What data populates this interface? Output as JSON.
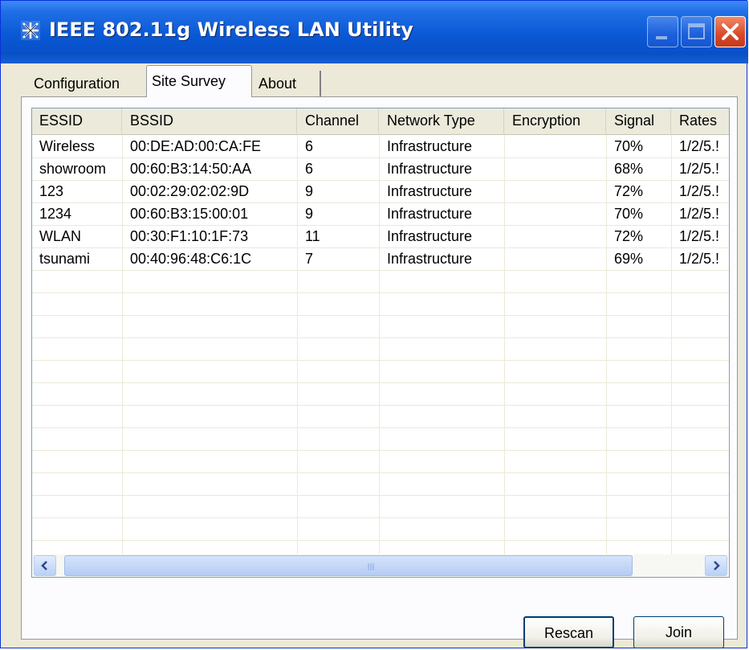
{
  "window": {
    "title": "IEEE 802.11g Wireless LAN Utility",
    "titlebar_color": "#0a58d4",
    "controls": [
      "minimize-icon",
      "maximize-icon",
      "close-icon"
    ]
  },
  "tabs": [
    {
      "label": "Configuration",
      "active": false
    },
    {
      "label": "Site Survey",
      "active": true
    },
    {
      "label": "About",
      "active": false
    }
  ],
  "site_survey": {
    "columns": [
      "ESSID",
      "BSSID",
      "Channel",
      "Network Type",
      "Encryption",
      "Signal",
      "Rates"
    ],
    "rows": [
      [
        "Wireless",
        "00:DE:AD:00:CA:FE",
        "6",
        "Infrastructure",
        "",
        "70%",
        "1/2/5.!"
      ],
      [
        "showroom",
        "00:60:B3:14:50:AA",
        "6",
        "Infrastructure",
        "",
        "68%",
        "1/2/5.!"
      ],
      [
        "123",
        "00:02:29:02:02:9D",
        "9",
        "Infrastructure",
        "",
        "72%",
        "1/2/5.!"
      ],
      [
        "1234",
        "00:60:B3:15:00:01",
        "9",
        "Infrastructure",
        "",
        "70%",
        "1/2/5.!"
      ],
      [
        "WLAN",
        "00:30:F1:10:1F:73",
        "11",
        "Infrastructure",
        "",
        "72%",
        "1/2/5.!"
      ],
      [
        "tsunami",
        "00:40:96:48:C6:1C",
        "7",
        "Infrastructure",
        "",
        "69%",
        "1/2/5.!"
      ]
    ]
  },
  "buttons": {
    "rescan": "Rescan",
    "join": "Join"
  }
}
